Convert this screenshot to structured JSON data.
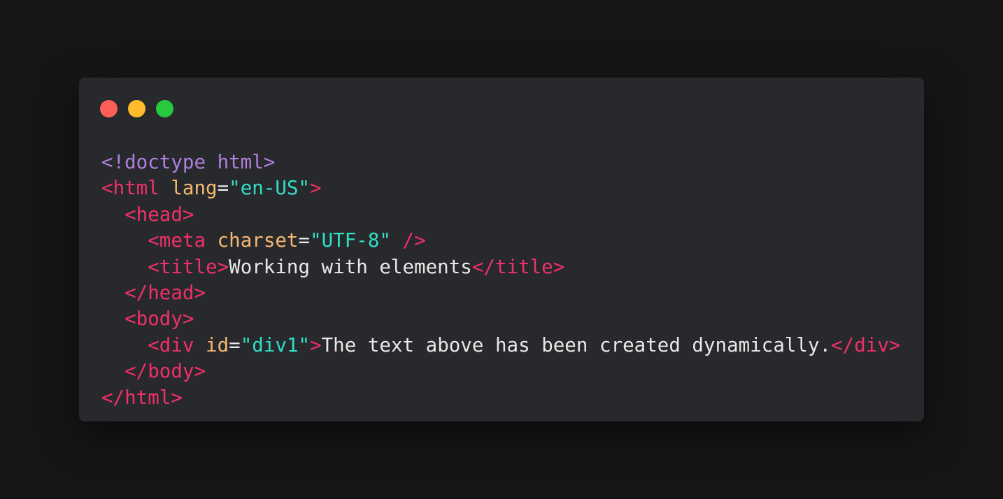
{
  "window": {
    "buttons": {
      "close_color": "#ff5f56",
      "minimize_color": "#ffbd2e",
      "maximize_color": "#27c93f"
    }
  },
  "code": {
    "lines": [
      [
        {
          "t": "doctype",
          "v": "<!doctype html>"
        }
      ],
      [
        {
          "t": "tag",
          "v": "<html"
        },
        {
          "t": "text",
          "v": " "
        },
        {
          "t": "attr",
          "v": "lang"
        },
        {
          "t": "eq",
          "v": "="
        },
        {
          "t": "str",
          "v": "\"en-US\""
        },
        {
          "t": "tag",
          "v": ">"
        }
      ],
      [
        {
          "t": "text",
          "v": "  "
        },
        {
          "t": "tag",
          "v": "<head>"
        }
      ],
      [
        {
          "t": "text",
          "v": "    "
        },
        {
          "t": "tag",
          "v": "<meta"
        },
        {
          "t": "text",
          "v": " "
        },
        {
          "t": "attr",
          "v": "charset"
        },
        {
          "t": "eq",
          "v": "="
        },
        {
          "t": "str",
          "v": "\"UTF-8\""
        },
        {
          "t": "text",
          "v": " "
        },
        {
          "t": "tag",
          "v": "/>"
        }
      ],
      [
        {
          "t": "text",
          "v": "    "
        },
        {
          "t": "tag",
          "v": "<title>"
        },
        {
          "t": "text",
          "v": "Working with elements"
        },
        {
          "t": "tag",
          "v": "</title>"
        }
      ],
      [
        {
          "t": "text",
          "v": "  "
        },
        {
          "t": "tag",
          "v": "</head>"
        }
      ],
      [
        {
          "t": "text",
          "v": "  "
        },
        {
          "t": "tag",
          "v": "<body>"
        }
      ],
      [
        {
          "t": "text",
          "v": "    "
        },
        {
          "t": "tag",
          "v": "<div"
        },
        {
          "t": "text",
          "v": " "
        },
        {
          "t": "attr",
          "v": "id"
        },
        {
          "t": "eq",
          "v": "="
        },
        {
          "t": "str",
          "v": "\"div1\""
        },
        {
          "t": "tag",
          "v": ">"
        },
        {
          "t": "text",
          "v": "The text above has been created dynamically."
        },
        {
          "t": "tag",
          "v": "</div>"
        }
      ],
      [
        {
          "t": "text",
          "v": "  "
        },
        {
          "t": "tag",
          "v": "</body>"
        }
      ],
      [
        {
          "t": "tag",
          "v": "</html>"
        }
      ]
    ]
  }
}
